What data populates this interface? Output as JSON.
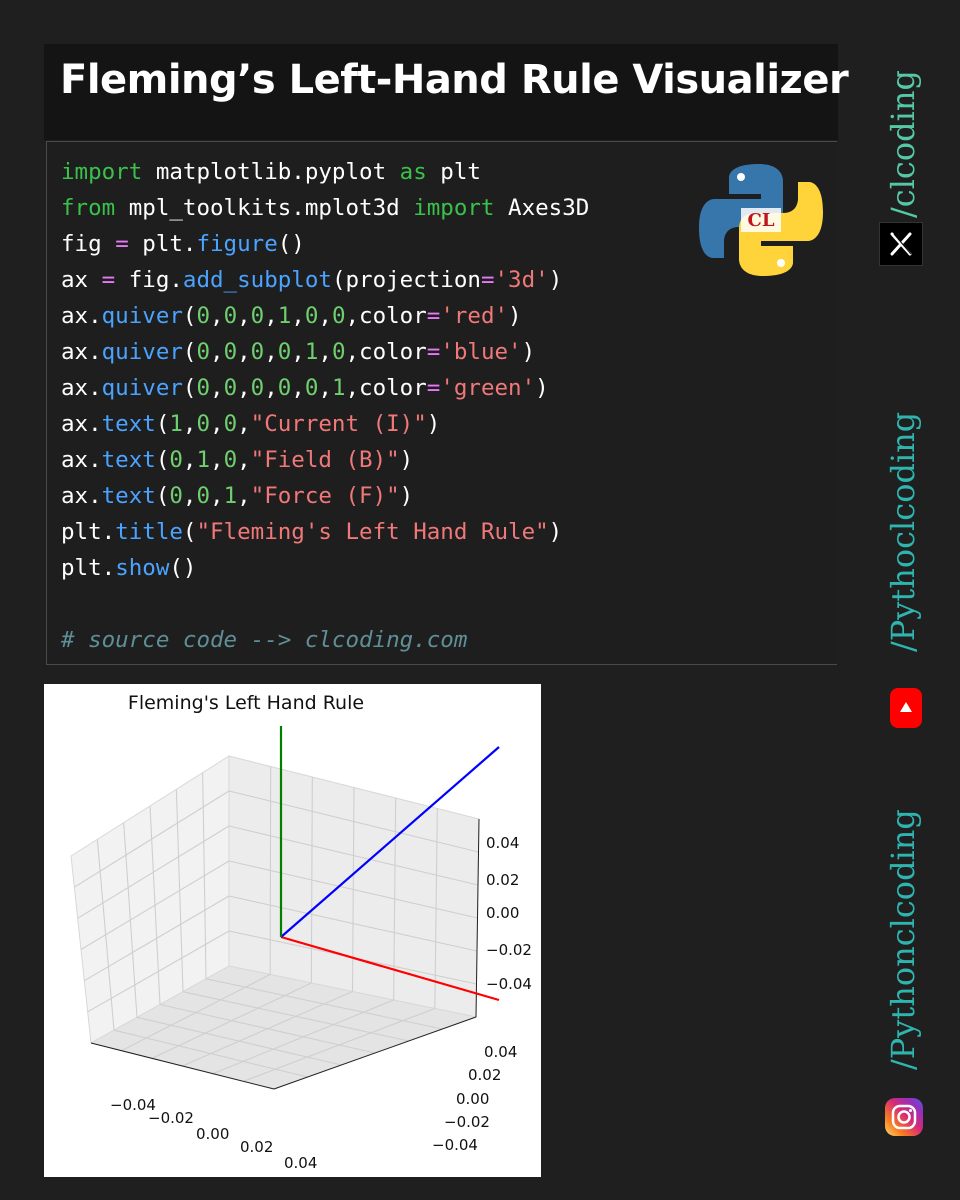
{
  "header": {
    "title": "Fleming’s Left-Hand Rule Visualizer"
  },
  "code": {
    "lines": [
      "import matplotlib.pyplot as plt",
      "from mpl_toolkits.mplot3d import Axes3D",
      "fig = plt.figure()",
      "ax = fig.add_subplot(projection='3d')",
      "ax.quiver(0,0,0,1,0,0,color='red')",
      "ax.quiver(0,0,0,0,1,0,color='blue')",
      "ax.quiver(0,0,0,0,0,1,color='green')",
      "ax.text(1,0,0,\"Current (I)\")",
      "ax.text(0,1,0,\"Field (B)\")",
      "ax.text(0,0,1,\"Force (F)\")",
      "plt.title(\"Fleming's Left Hand Rule\")",
      "plt.show()",
      "",
      "# source code --> clcoding.com"
    ],
    "logo_text": "CL"
  },
  "chart_data": {
    "type": "3d-quiver",
    "title": "Fleming's Left Hand Rule",
    "series": [
      {
        "origin": [
          0,
          0,
          0
        ],
        "direction": [
          1,
          0,
          0
        ],
        "color": "#ff0000"
      },
      {
        "origin": [
          0,
          0,
          0
        ],
        "direction": [
          0,
          1,
          0
        ],
        "color": "#0000ff"
      },
      {
        "origin": [
          0,
          0,
          0
        ],
        "direction": [
          0,
          0,
          1
        ],
        "color": "#008000"
      }
    ],
    "x_ticks": [
      "−0.04",
      "−0.02",
      "0.00",
      "0.02",
      "0.04"
    ],
    "y_ticks": [
      "0.04",
      "0.02",
      "0.00",
      "−0.02",
      "−0.04"
    ],
    "z_ticks": [
      "0.04",
      "0.02",
      "0.00",
      "−0.02",
      "−0.04"
    ],
    "grid": true
  },
  "social": {
    "x_handle": "/clcoding",
    "youtube_handle": "/Pythoclcoding",
    "instagram_handle": "/Pythonclcoding",
    "x_icon": "x-logo-icon",
    "youtube_icon": "youtube-play-icon",
    "instagram_icon": "instagram-camera-icon"
  },
  "colors": {
    "background": "#1f1f1f",
    "keyword": "#39c14b",
    "function": "#4aa3ff",
    "string": "#f07878",
    "number": "#6fcf6f",
    "operator": "#e879f9",
    "comment": "#5f8f96",
    "handle": "#2eb5b0"
  }
}
